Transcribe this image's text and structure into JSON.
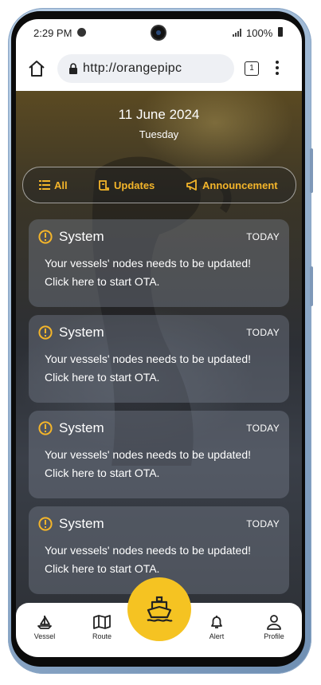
{
  "status_bar": {
    "time": "2:29 PM",
    "battery": "100%"
  },
  "browser": {
    "url": "http://orangepipc",
    "tab_count": "1"
  },
  "header": {
    "date": "11 June 2024",
    "weekday": "Tuesday"
  },
  "filters": {
    "all": "All",
    "updates": "Updates",
    "announcement": "Announcement"
  },
  "notifications": [
    {
      "title": "System",
      "time": "TODAY",
      "line1": "Your vessels' nodes needs to be updated!",
      "line2": "Click here to start OTA."
    },
    {
      "title": "System",
      "time": "TODAY",
      "line1": "Your vessels' nodes needs to be updated!",
      "line2": "Click here to start OTA."
    },
    {
      "title": "System",
      "time": "TODAY",
      "line1": "Your vessels' nodes needs to be updated!",
      "line2": "Click here to start OTA."
    },
    {
      "title": "System",
      "time": "TODAY",
      "line1": "Your vessels' nodes needs to be updated!",
      "line2": "Click here to start OTA."
    }
  ],
  "nav": {
    "vessel": "Vessel",
    "route": "Route",
    "alert": "Alert",
    "profile": "Profile"
  },
  "colors": {
    "accent": "#f4b52a",
    "fab": "#f5c322"
  }
}
